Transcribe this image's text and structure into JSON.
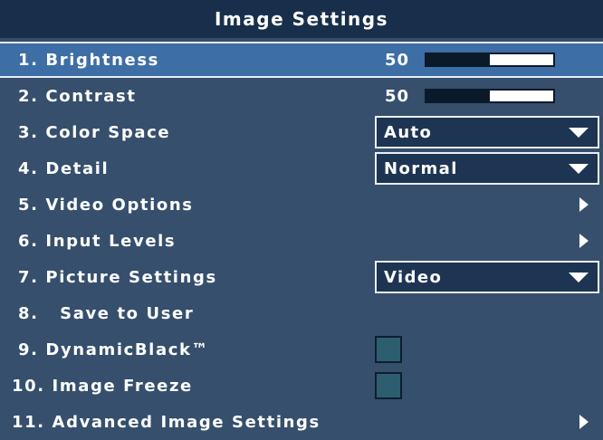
{
  "title": "Image Settings",
  "colors": {
    "background": "#354f6c",
    "title_bar": "#182f4b",
    "selected_row": "#3d6ea6"
  },
  "items": [
    {
      "label": "1. Brightness",
      "control": "slider",
      "value": "50",
      "level": 0.5,
      "selected": true
    },
    {
      "label": "2. Contrast",
      "control": "slider",
      "value": "50",
      "level": 0.5
    },
    {
      "label": "3. Color Space",
      "control": "dropdown",
      "value": "Auto"
    },
    {
      "label": "4. Detail",
      "control": "dropdown",
      "value": "Normal"
    },
    {
      "label": "5. Video Options",
      "control": "submenu",
      "icon": "chevron-right-icon"
    },
    {
      "label": "6. Input Levels",
      "control": "submenu",
      "icon": "chevron-right-icon"
    },
    {
      "label": "7. Picture Settings",
      "control": "dropdown",
      "value": "Video"
    },
    {
      "label": "8.   Save to User",
      "control": "none"
    },
    {
      "label": "9. DynamicBlack™",
      "control": "checkbox",
      "checked": false
    },
    {
      "label": "10. Image Freeze",
      "control": "checkbox",
      "checked": false
    },
    {
      "label": "11. Advanced Image Settings",
      "control": "submenu",
      "icon": "chevron-right-icon"
    }
  ]
}
